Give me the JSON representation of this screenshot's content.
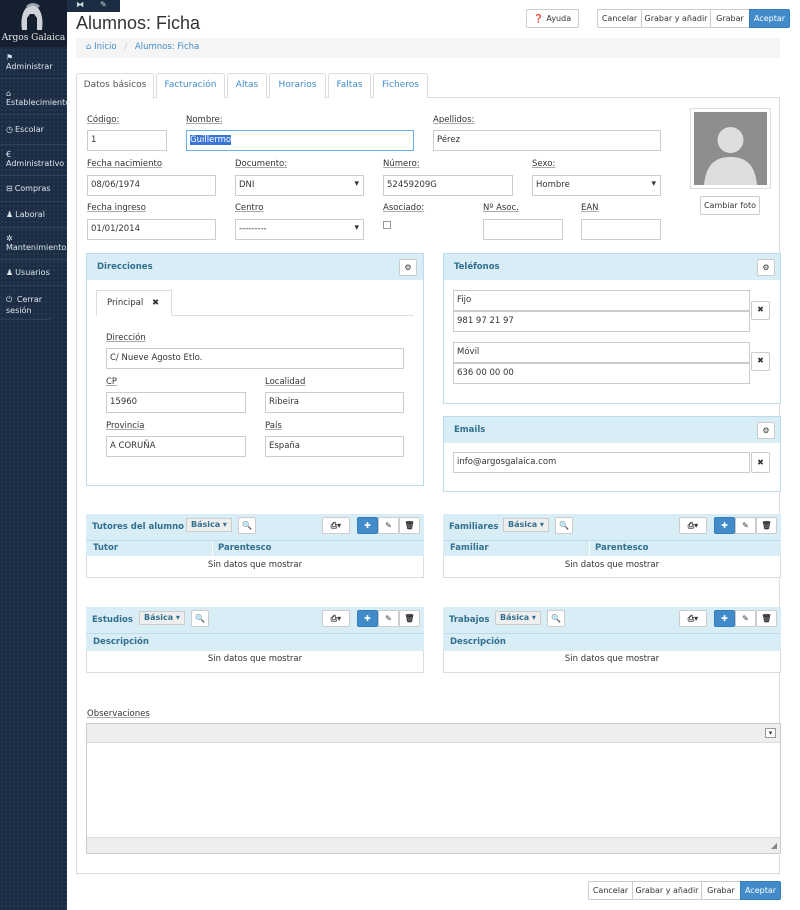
{
  "sidebar": {
    "brand": "Argos Galaica",
    "items": [
      {
        "icon": "flag-icon",
        "glyph": "⚑",
        "label": "Administrar"
      },
      {
        "icon": "home-icon",
        "glyph": "⌂",
        "label": "Establecimiento"
      },
      {
        "icon": "clock-icon",
        "glyph": "◷",
        "label": "Escolar"
      },
      {
        "icon": "euro-icon",
        "glyph": "€",
        "label": "Administrativo"
      },
      {
        "icon": "cart-icon",
        "glyph": "⊟",
        "label": "Compras"
      },
      {
        "icon": "user-icon",
        "glyph": "♟",
        "label": "Laboral"
      },
      {
        "icon": "gear-icon",
        "glyph": "✲",
        "label": "Mantenimiento"
      },
      {
        "icon": "user-icon",
        "glyph": "♟",
        "label": "Usuarios"
      },
      {
        "icon": "power-icon",
        "glyph": "⏻",
        "label": "Cerrar sesión"
      }
    ]
  },
  "header": {
    "title": "Alumnos: Ficha",
    "help_label": "Ayuda",
    "actions": [
      "Cancelar",
      "Grabar y añadir",
      "Grabar",
      "Aceptar"
    ]
  },
  "breadcrumb": {
    "home": "Inicio",
    "sep": "/",
    "current": "Alumnos: Ficha"
  },
  "tabs": [
    "Datos básicos",
    "Facturación",
    "Altas",
    "Horarios",
    "Faltas",
    "Ficheros"
  ],
  "form": {
    "codigo": {
      "label": "Código:",
      "value": "1"
    },
    "nombre": {
      "label": "Nombre:",
      "value": "Guillermo"
    },
    "apellidos": {
      "label": "Apellidos:",
      "value": "Pérez"
    },
    "fecha_nac": {
      "label": "Fecha nacimiento",
      "value": "08/06/1974"
    },
    "documento": {
      "label": "Documento:",
      "value": "DNI"
    },
    "numero": {
      "label": "Número:",
      "value": "52459209G"
    },
    "sexo": {
      "label": "Sexo:",
      "value": "Hombre"
    },
    "fecha_ingreso": {
      "label": "Fecha ingreso",
      "value": "01/01/2014"
    },
    "centro": {
      "label": "Centro",
      "value": "---------"
    },
    "asociado": {
      "label": "Asociado:"
    },
    "n_asoc": {
      "label": "Nº Asoc.",
      "value": ""
    },
    "ean": {
      "label": "EAN",
      "value": ""
    },
    "photo_button": "Cambiar foto"
  },
  "direcciones": {
    "title": "Direcciones",
    "tab": "Principal",
    "direccion": {
      "label": "Dirección",
      "value": "C/ Nueve Agosto Etlo."
    },
    "cp": {
      "label": "CP",
      "value": "15960"
    },
    "localidad": {
      "label": "Localidad",
      "value": "Ribeira"
    },
    "provincia": {
      "label": "Provincia",
      "value": "A CORUÑA"
    },
    "pais": {
      "label": "País",
      "value": "España"
    }
  },
  "telefonos": {
    "title": "Teléfonos",
    "items": [
      {
        "tipo": "Fijo",
        "numero": "981 97 21 97"
      },
      {
        "tipo": "Móvil",
        "numero": "636 00 00 00"
      }
    ]
  },
  "emails": {
    "title": "Emails",
    "value": "info@argosgalaica.com"
  },
  "grids": {
    "basic_label": "Básica",
    "empty": "Sin datos que mostrar",
    "tutores": {
      "title": "Tutores del alumno",
      "cols": [
        "Tutor",
        "Parentesco"
      ]
    },
    "familiares": {
      "title": "Familiares",
      "cols": [
        "Familiar",
        "Parentesco"
      ]
    },
    "estudios": {
      "title": "Estudios",
      "cols": [
        "Descripción"
      ]
    },
    "trabajos": {
      "title": "Trabajos",
      "cols": [
        "Descripción"
      ]
    }
  },
  "observaciones": {
    "label": "Observaciones"
  },
  "colors": {
    "primary": "#428bca",
    "info_bg": "#d9edf7",
    "info_text": "#31708f",
    "sidebar": "#1c2c42"
  }
}
